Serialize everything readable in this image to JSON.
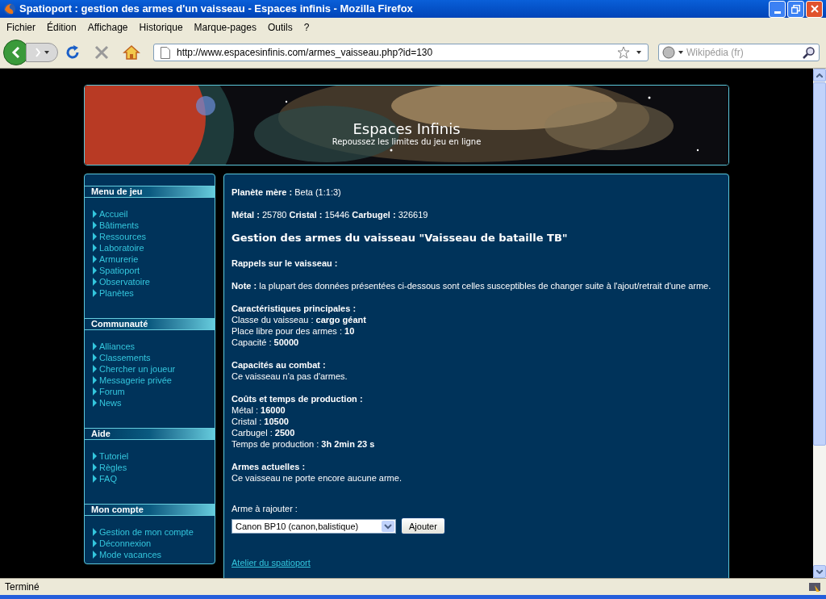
{
  "window": {
    "title": "Spatioport : gestion des armes d'un vaisseau - Espaces infinis - Mozilla Firefox"
  },
  "menu_bar": [
    "Fichier",
    "Édition",
    "Affichage",
    "Historique",
    "Marque-pages",
    "Outils",
    "?"
  ],
  "toolbar": {
    "url": "http://www.espacesinfinis.com/armes_vaisseau.php?id=130",
    "search": {
      "placeholder": "Wikipédia (fr)"
    }
  },
  "banner": {
    "title": "Espaces Infinis",
    "subtitle": "Repoussez les limites du jeu en ligne"
  },
  "sidebar": [
    {
      "title": "Menu de jeu",
      "items": [
        "Accueil",
        "Bâtiments",
        "Ressources",
        "Laboratoire",
        "Armurerie",
        "Spatioport",
        "Observatoire",
        "Planètes"
      ]
    },
    {
      "title": "Communauté",
      "items": [
        "Alliances",
        "Classements",
        "Chercher un joueur",
        "Messagerie privée",
        "Forum",
        "News"
      ]
    },
    {
      "title": "Aide",
      "items": [
        "Tutoriel",
        "Règles",
        "FAQ"
      ]
    },
    {
      "title": "Mon compte",
      "items": [
        "Gestion de mon compte",
        "Déconnexion",
        "Mode vacances"
      ]
    }
  ],
  "main": {
    "blocks": [
      {
        "kind": "line",
        "text": "**Planète mère :** Beta (1:1:3)"
      },
      {
        "kind": "line",
        "text": "**Métal :** 25780 **Cristal :** 15446 **Carbugel :** 326619"
      },
      {
        "kind": "heading",
        "text": "Gestion des armes du vaisseau \"Vaisseau de bataille TB\""
      },
      {
        "kind": "section",
        "title": "Rappels sur le vaisseau :"
      },
      {
        "kind": "line",
        "text": "**Note :** la plupart des données présentées ci-dessous sont celles susceptibles de changer suite à l'ajout/retrait d'une arme."
      },
      {
        "kind": "section",
        "title": "Caractéristiques principales :",
        "lines": [
          "Classe du vaisseau : **cargo géant**",
          "Place libre pour des armes : **10**",
          "Capacité : **50000**"
        ]
      },
      {
        "kind": "section",
        "title": "Capacités au combat :",
        "lines": [
          "Ce vaisseau n'a pas d'armes."
        ]
      },
      {
        "kind": "section",
        "title": "Coûts et temps de production :",
        "lines": [
          "Métal : **16000**",
          "Cristal : **10500**",
          "Carbugel : **2500**",
          "Temps de production : **3h 2min 23 s**"
        ]
      },
      {
        "kind": "section",
        "title": "Armes actuelles :",
        "lines": [
          "Ce vaisseau ne porte encore aucune arme."
        ]
      }
    ],
    "form": {
      "label": "Arme à rajouter :",
      "select": "Canon BP10 (canon,balistique)",
      "button": "Ajouter"
    },
    "link": "Atelier du spatioport"
  },
  "status_bar": {
    "text": "Terminé"
  }
}
